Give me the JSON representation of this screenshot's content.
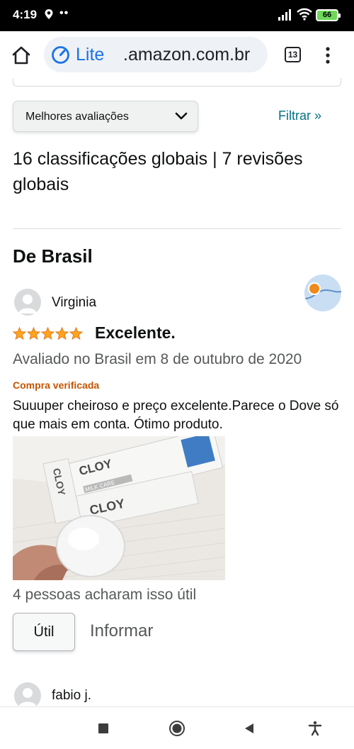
{
  "status_bar": {
    "time": "4:19",
    "dots": "••",
    "battery": "66"
  },
  "browser": {
    "lite_label": "Lite",
    "url": ".amazon.com.br",
    "tab_count": "13"
  },
  "controls": {
    "sort_selected": "Melhores avaliações",
    "filter_label": "Filtrar »"
  },
  "summary": "16 classificações globais | 7 revisões globais",
  "section_title": "De Brasil",
  "reviews": [
    {
      "author": "Virginia",
      "rating": 5,
      "rating_max": 5,
      "title": "Excelente.",
      "date": "Avaliado no Brasil em 8 de outubro de 2020",
      "badge": "Compra verificada",
      "body": "Suuuper cheiroso e preço excelente.Parece o Dove só que mais em conta. Ótimo produto.",
      "photo_text": {
        "brand": "CLOY",
        "milk_care": "MILK CARE"
      },
      "helpful_text": "4 pessoas acharam isso útil",
      "useful_label": "Útil",
      "report_label": "Informar"
    },
    {
      "author": "fabio j."
    }
  ],
  "colors": {
    "link": "#007185",
    "star": "#ffa41c",
    "verified": "#c45500",
    "lite_blue": "#1a73e8",
    "battery": "#6fd85a"
  },
  "icons": {
    "status_location": "location-pin-icon",
    "home": "home-icon",
    "lite": "lite-speed-icon",
    "menu": "more-vert-icon",
    "sort_dropdown": "chevron-down-icon",
    "nav_recents": "square-icon",
    "nav_home": "circle-icon",
    "nav_back": "back-triangle-icon",
    "nav_accessibility": "accessibility-icon"
  }
}
